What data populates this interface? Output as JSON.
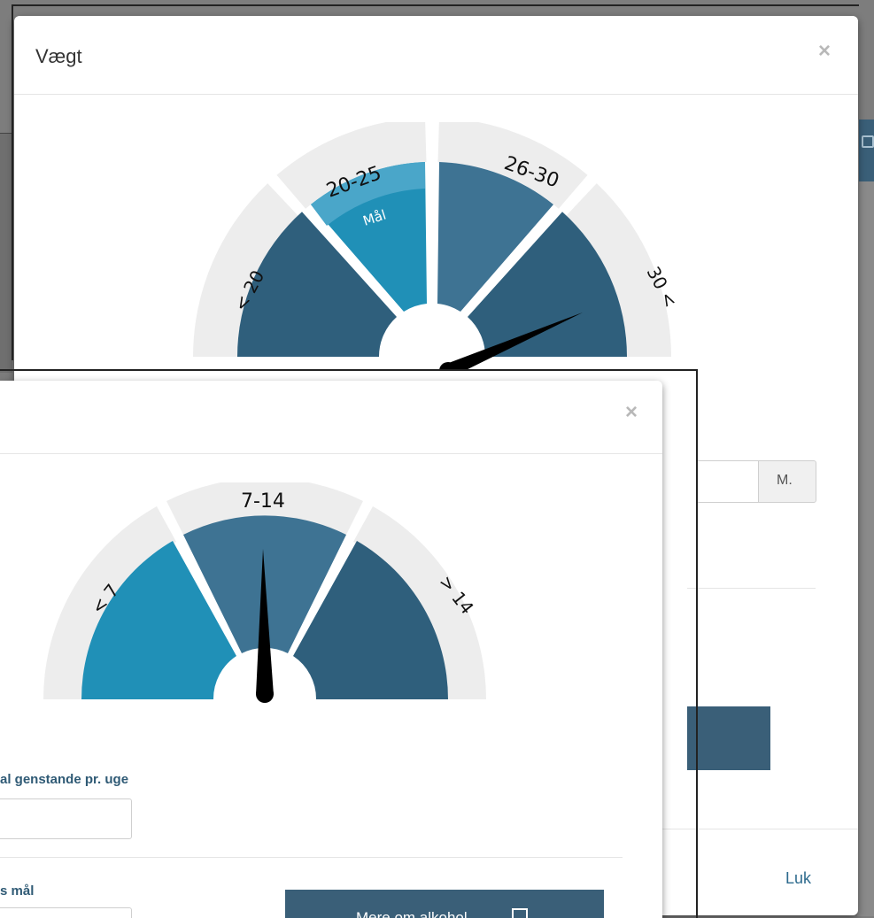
{
  "weight_modal": {
    "title": "Vægt",
    "close_symbol": "×",
    "gauge_labels": {
      "low": "< 20",
      "goal_range": "20-25",
      "goal_tag": "Mål",
      "mid": "26-30",
      "high": "30 <"
    },
    "input_unit_label": "M.",
    "footer_close_label": "Luk",
    "colors": {
      "teal": "#2090b7",
      "teal_light": "#4aa6c9",
      "steel": "#3e7393",
      "slate": "#2f5f7c",
      "ring": "#ededed"
    }
  },
  "alcohol_modal": {
    "close_symbol": "×",
    "gauge_labels": {
      "low": "< 7",
      "mid": "7-14",
      "high": "> 14"
    },
    "units_label": "al genstande pr. uge",
    "goal_label": "s mål",
    "more_button_label": "Mere om alkohol",
    "external_link_icon": "external-link-icon"
  },
  "background": {
    "save_icon": "save-icon"
  }
}
